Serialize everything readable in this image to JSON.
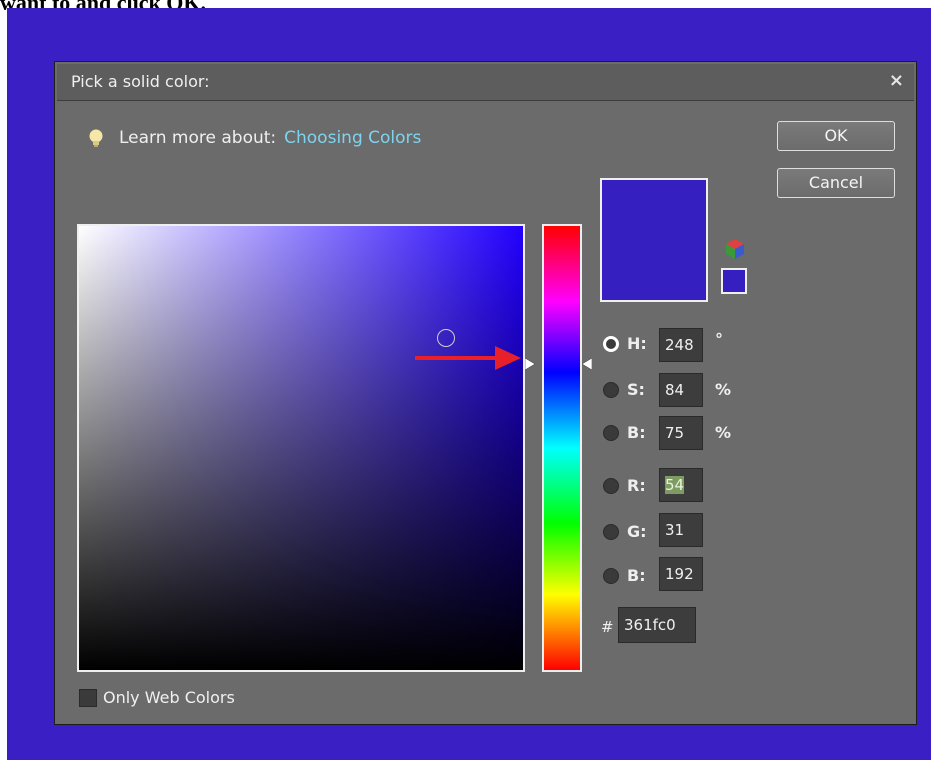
{
  "page": {
    "caption_fragment": "want to and click OK."
  },
  "dialog": {
    "title": "Pick a solid color:",
    "close_glyph": "×",
    "learn_prefix": "Learn more about:",
    "learn_link": "Choosing Colors",
    "ok_label": "OK",
    "cancel_label": "Cancel",
    "current_color_hex": "#361fc0",
    "fields": {
      "h": {
        "label": "H:",
        "value": "248",
        "unit": "°",
        "selected": true
      },
      "s": {
        "label": "S:",
        "value": "84",
        "unit": "%"
      },
      "b": {
        "label": "B:",
        "value": "75",
        "unit": "%"
      },
      "r": {
        "label": "R:",
        "value": "54"
      },
      "g": {
        "label": "G:",
        "value": "31"
      },
      "b2": {
        "label": "B:",
        "value": "192"
      }
    },
    "hex_prefix": "#",
    "hex_value": "361fc0",
    "web_colors_label": "Only Web Colors"
  },
  "colors": {
    "backdrop": "#3a1fc4",
    "dialog_bg": "#6b6b6b",
    "link": "#7fd3ee",
    "annotation_arrow": "#e8202a"
  },
  "icons": [
    "lightbulb-icon",
    "close-icon",
    "color-cube-icon",
    "annotation-arrow-icon"
  ]
}
